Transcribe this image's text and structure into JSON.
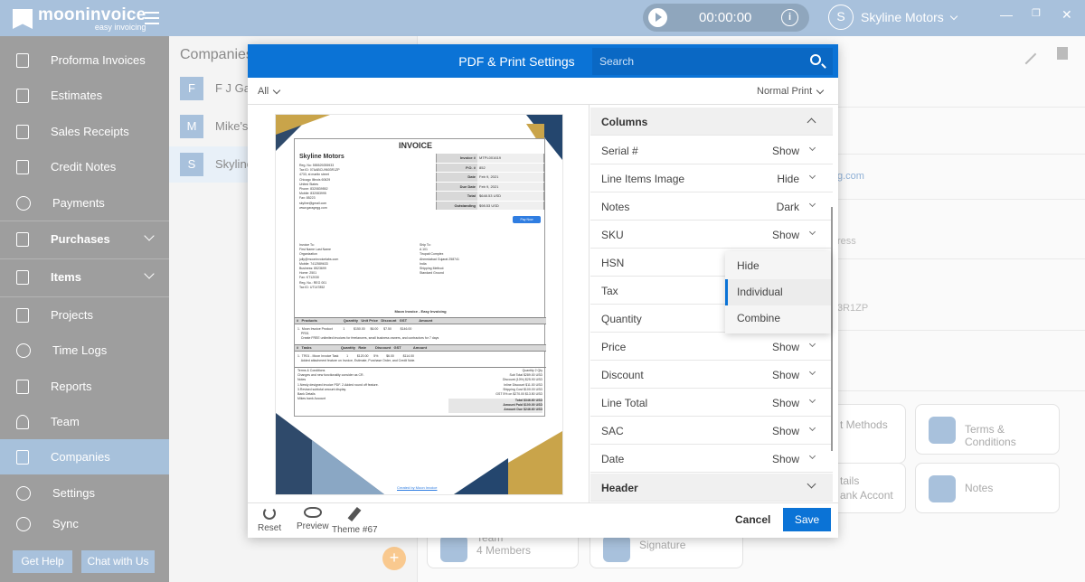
{
  "app": {
    "logo_name": "mooninvoice",
    "logo_tagline": "easy invoicing",
    "timer": "00:00:00",
    "user_initial": "S",
    "user_name": "Skyline Motors"
  },
  "sidebar": {
    "items": [
      {
        "label": "Proforma Invoices"
      },
      {
        "label": "Estimates"
      },
      {
        "label": "Sales Receipts"
      },
      {
        "label": "Credit Notes"
      },
      {
        "label": "Payments"
      },
      {
        "label": "Purchases"
      },
      {
        "label": "Items"
      },
      {
        "label": "Projects"
      },
      {
        "label": "Time Logs"
      },
      {
        "label": "Reports"
      },
      {
        "label": "Team"
      },
      {
        "label": "Companies"
      },
      {
        "label": "Settings"
      },
      {
        "label": "Sync"
      }
    ],
    "help_btn": "Get Help",
    "chat_btn": "Chat with Us"
  },
  "companies": {
    "title": "Companies",
    "rows": [
      {
        "initial": "F",
        "name": "F J Gar"
      },
      {
        "initial": "M",
        "name": "Mike's"
      },
      {
        "initial": "S",
        "name": "Skyline"
      }
    ]
  },
  "background": {
    "email_fragment": "g.com",
    "address_fragment": "ress",
    "tax_fragment": "3R1ZP",
    "payment_methods_fragment": "t Methods",
    "terms_label": "Terms & Conditions",
    "bank_fragment": "tails",
    "bank_sub": "ank Accont",
    "notes_label": "Notes",
    "team_label": "Team",
    "team_sub": "4 Members",
    "signature_label": "Signature"
  },
  "modal": {
    "title": "PDF & Print Settings",
    "search_placeholder": "Search",
    "filter_all": "All",
    "print_mode": "Normal Print",
    "footer": {
      "reset": "Reset",
      "preview": "Preview",
      "theme": "Theme #67",
      "cancel": "Cancel",
      "save": "Save"
    }
  },
  "settings": {
    "columns_header": "Columns",
    "rows": [
      {
        "label": "Serial #",
        "value": "Show"
      },
      {
        "label": "Line Items Image",
        "value": "Hide"
      },
      {
        "label": "Notes",
        "value": "Dark"
      },
      {
        "label": "SKU",
        "value": "Show"
      },
      {
        "label": "HSN",
        "value": ""
      },
      {
        "label": "Tax",
        "value": ""
      },
      {
        "label": "Quantity",
        "value": ""
      },
      {
        "label": "Price",
        "value": "Show"
      },
      {
        "label": "Discount",
        "value": "Show"
      },
      {
        "label": "Line Total",
        "value": "Show"
      },
      {
        "label": "SAC",
        "value": "Show"
      },
      {
        "label": "Date",
        "value": "Show"
      }
    ],
    "header_section": "Header"
  },
  "dropdown": {
    "options": [
      "Hide",
      "Individual",
      "Combine"
    ],
    "selected": "Individual"
  },
  "invoice": {
    "title": "INVOICE",
    "company": "Skyline Motors",
    "address_lines": "Reg. No: 555529255933\nTax ID: 07AABCU9603R1ZP\n4733, st martin street\nChicago Illinois 60629\nUnited States\nPhone: 8320839552\nMobile: 832083995\nFax: 85223\nskyline@gmail.com\nwww.garagegg.com",
    "meta": [
      {
        "k": "Invoice #",
        "v": "MTPL001619"
      },
      {
        "k": "P.O. #",
        "v": "852"
      },
      {
        "k": "Date",
        "v": "Feb 9, 2021"
      },
      {
        "k": "Due Date",
        "v": "Feb 9, 2021"
      },
      {
        "k": "Total",
        "v": "$648.53 USD"
      },
      {
        "k": "Outstanding",
        "v": "$98.53 USD"
      }
    ],
    "pay_now": "Pay Now",
    "bill_to": "Invoice To:\nFirst Name Last Name\nOrganization\njully@mooninvoicelabs.com\nMobile: 7412589633\nBusiness: 8523699\nHome: 2501\nFax: KT12030\nReg. No.: REG 001\nTax ID: UT147852",
    "ship_to": "Ship To:\nA 101\nTirupati Complex\nAhmedabad Gujarat 258741\nIndia\nShipping Method:\nStandard Ground",
    "tagline": "Moon Invoice - Easy Invoicing",
    "products_header": "#   Products                          Quantity   Unit Price   Discount   GST            Amount",
    "product_line": "1.  Moon Invoice Product            1          $150.00      $6.00      $7.50          $146.00\n    PR01\n    Create FREE unlimited invoices for freelancers, small business owners, and contractors for 7 days",
    "tasks_header": "#   Tasks                             Quantity   Rate         Discount   GST            Amount",
    "task_line": "1.  TR01 - Moon Invoice Task         1          $120.00      5%         $6.00          $114.00\n    Added attachment feature on Invoice, Estimate, Purchase Order, and Credit Note.",
    "terms": "Terms & Conditions\nChanges and new functionality consider as CR.\nNotes\n1.Newly designed invoice PDF.  2.Added round off feature.\n3.Revised subtotal amount display.\nBank Details\nMikes bank Account",
    "totals": "Quantity  2 Qty\nSub Total  $289.00 USD\nDiscount (10%)  $25.90 USD\nInline Discount  $11.00 USD\nShipping Cost  $100.00 USD\nGST 5% on $270.00  $13.50 USD",
    "grand": "Total  $346.60 USD\nAmount Paid  $100.00 USD\nAmount Due  $246.60 USD",
    "footer_link": "Created by Moon Invoice"
  },
  "colors": {
    "topbar": "#a8c1dc",
    "sidebar": "#9e9e9e",
    "modal_header": "#0b73d6",
    "accent": "#0b73d6"
  }
}
